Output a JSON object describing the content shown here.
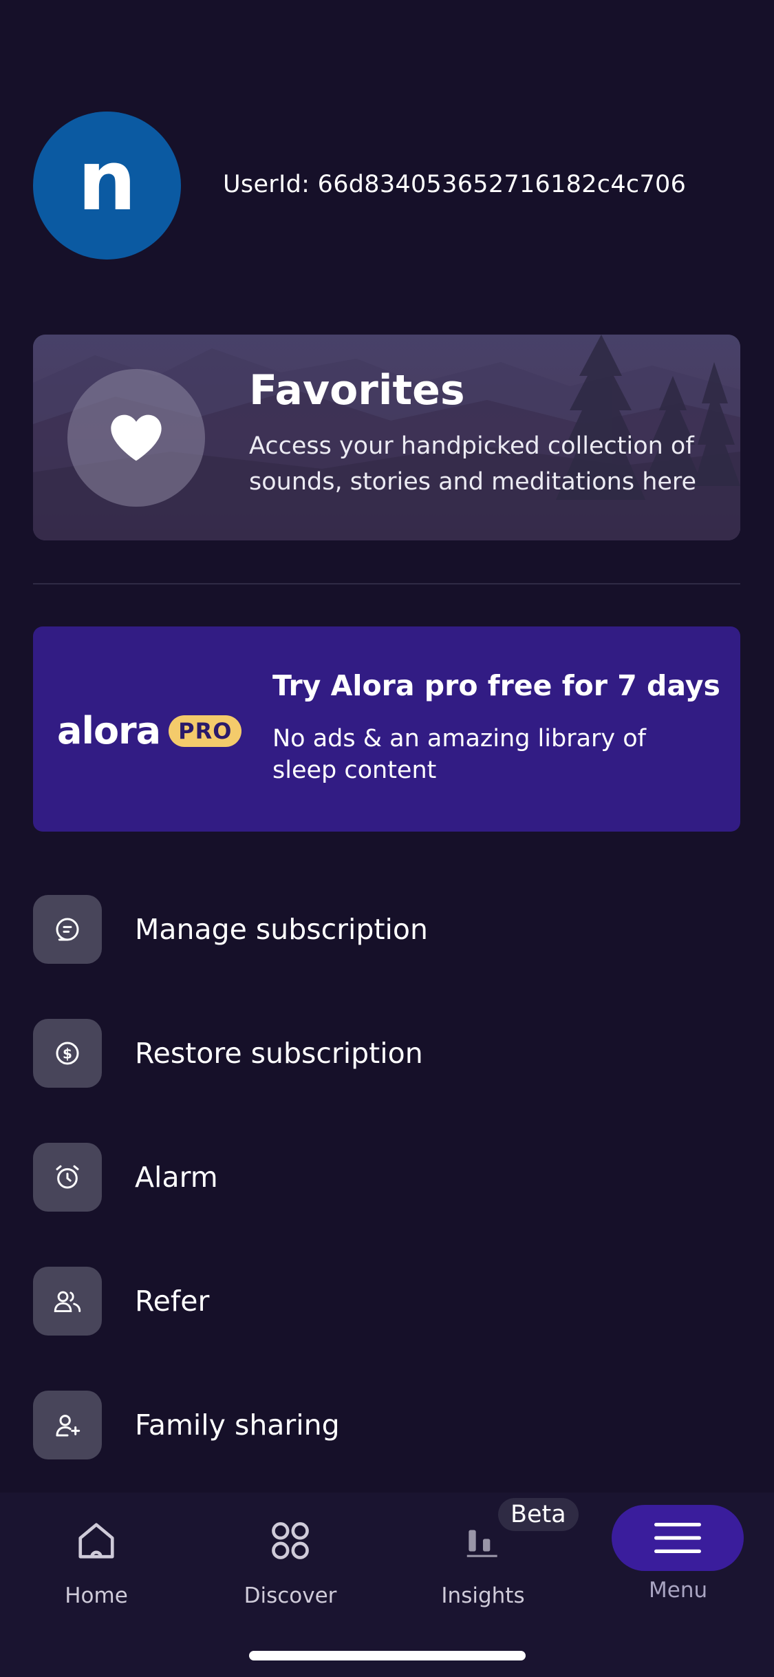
{
  "profile": {
    "avatar_letter": "n",
    "user_id_text": "UserId: 66d834053652716182c4c706"
  },
  "favorites": {
    "title": "Favorites",
    "description": "Access your handpicked collection of sounds, stories and meditations here",
    "icon": "heart-icon"
  },
  "pro_banner": {
    "logo_text": "alora",
    "badge": "PRO",
    "title": "Try Alora pro free for 7 days",
    "description": "No ads & an amazing library of sleep content"
  },
  "menu": {
    "items": [
      {
        "label": "Manage subscription",
        "icon": "manage-subscription-icon"
      },
      {
        "label": "Restore subscription",
        "icon": "dollar-coin-icon"
      },
      {
        "label": "Alarm",
        "icon": "alarm-clock-icon"
      },
      {
        "label": "Refer",
        "icon": "users-icon"
      },
      {
        "label": "Family sharing",
        "icon": "user-add-icon"
      }
    ]
  },
  "nav": {
    "items": [
      {
        "label": "Home",
        "icon": "home-icon"
      },
      {
        "label": "Discover",
        "icon": "discover-grid-icon"
      },
      {
        "label": "Insights",
        "icon": "insights-bars-icon"
      },
      {
        "label": "Menu",
        "icon": "hamburger-menu-icon"
      }
    ],
    "beta_label": "Beta",
    "active": "Menu"
  },
  "colors": {
    "background": "#161029",
    "avatar": "#0b5aa2",
    "pro_banner": "#321c84",
    "pro_badge": "#f4cb6b",
    "menu_pill": "#3a1d9c"
  }
}
